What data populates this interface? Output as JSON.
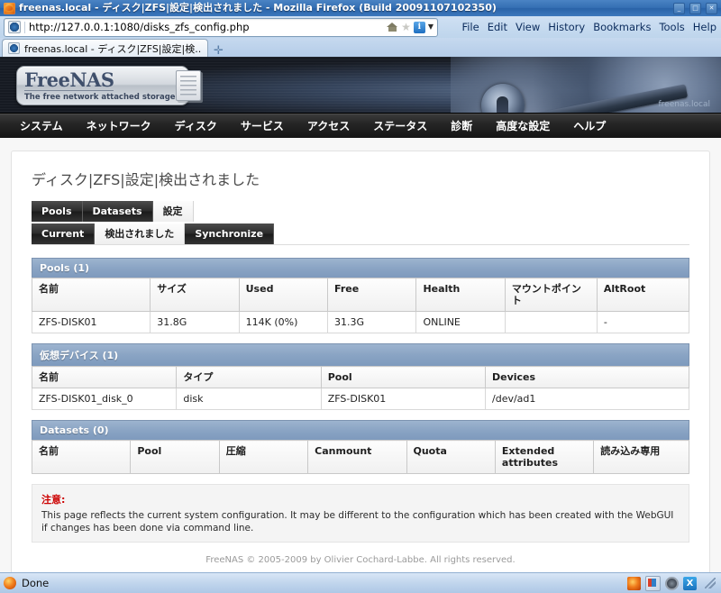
{
  "window": {
    "title": "freenas.local - ディスク|ZFS|設定|検出されました - Mozilla Firefox (Build 20091107102350)",
    "minimize_label": "_",
    "maximize_label": "□",
    "close_label": "✕"
  },
  "browser": {
    "url": "http://127.0.0.1:1080/disks_zfs_config.php",
    "tab_title": "freenas.local - ディスク|ZFS|設定|検...",
    "new_tab_label": "✛",
    "menus": [
      {
        "label": "File",
        "accesskey": "F"
      },
      {
        "label": "Edit",
        "accesskey": "E"
      },
      {
        "label": "View",
        "accesskey": "V"
      },
      {
        "label": "History",
        "accesskey": "s"
      },
      {
        "label": "Bookmarks",
        "accesskey": "B"
      },
      {
        "label": "Tools",
        "accesskey": "T"
      },
      {
        "label": "Help",
        "accesskey": "H"
      }
    ],
    "info_icon_label": "i"
  },
  "banner": {
    "logo_title": "FreeNAS",
    "logo_subtitle": "The free network attached storage",
    "hostname": "freenas.local"
  },
  "nav": {
    "items": [
      {
        "label": "システム"
      },
      {
        "label": "ネットワーク"
      },
      {
        "label": "ディスク"
      },
      {
        "label": "サービス"
      },
      {
        "label": "アクセス"
      },
      {
        "label": "ステータス"
      },
      {
        "label": "診断"
      },
      {
        "label": "高度な設定"
      },
      {
        "label": "ヘルプ"
      }
    ]
  },
  "page": {
    "title": "ディスク|ZFS|設定|検出されました",
    "tabs_primary": [
      {
        "label": "Pools",
        "active": false
      },
      {
        "label": "Datasets",
        "active": false
      },
      {
        "label": "設定",
        "active": true
      }
    ],
    "tabs_secondary": [
      {
        "label": "Current",
        "active": false
      },
      {
        "label": "検出されました",
        "active": true
      },
      {
        "label": "Synchronize",
        "active": false
      }
    ]
  },
  "tables": {
    "pools": {
      "caption": "Pools (1)",
      "headers": [
        "名前",
        "サイズ",
        "Used",
        "Free",
        "Health",
        "マウントポイント",
        "AltRoot"
      ],
      "rows": [
        [
          "ZFS-DISK01",
          "31.8G",
          "114K (0%)",
          "31.3G",
          "ONLINE",
          "",
          "-"
        ]
      ]
    },
    "vdevs": {
      "caption": "仮想デバイス (1)",
      "headers": [
        "名前",
        "タイプ",
        "Pool",
        "Devices"
      ],
      "rows": [
        [
          "ZFS-DISK01_disk_0",
          "disk",
          "ZFS-DISK01",
          "/dev/ad1"
        ]
      ]
    },
    "datasets": {
      "caption": "Datasets (0)",
      "headers": [
        "名前",
        "Pool",
        "圧縮",
        "Canmount",
        "Quota",
        "Extended attributes",
        "読み込み専用"
      ],
      "rows": []
    }
  },
  "note": {
    "title": "注意:",
    "body": "This page reflects the current system configuration. It may be different to the configuration which has been created with the WebGUI if changes has been done via command line."
  },
  "footer": {
    "copyright": "FreeNAS © 2005-2009 by Olivier Cochard-Labbe. All rights reserved."
  },
  "statusbar": {
    "text": "Done"
  }
}
